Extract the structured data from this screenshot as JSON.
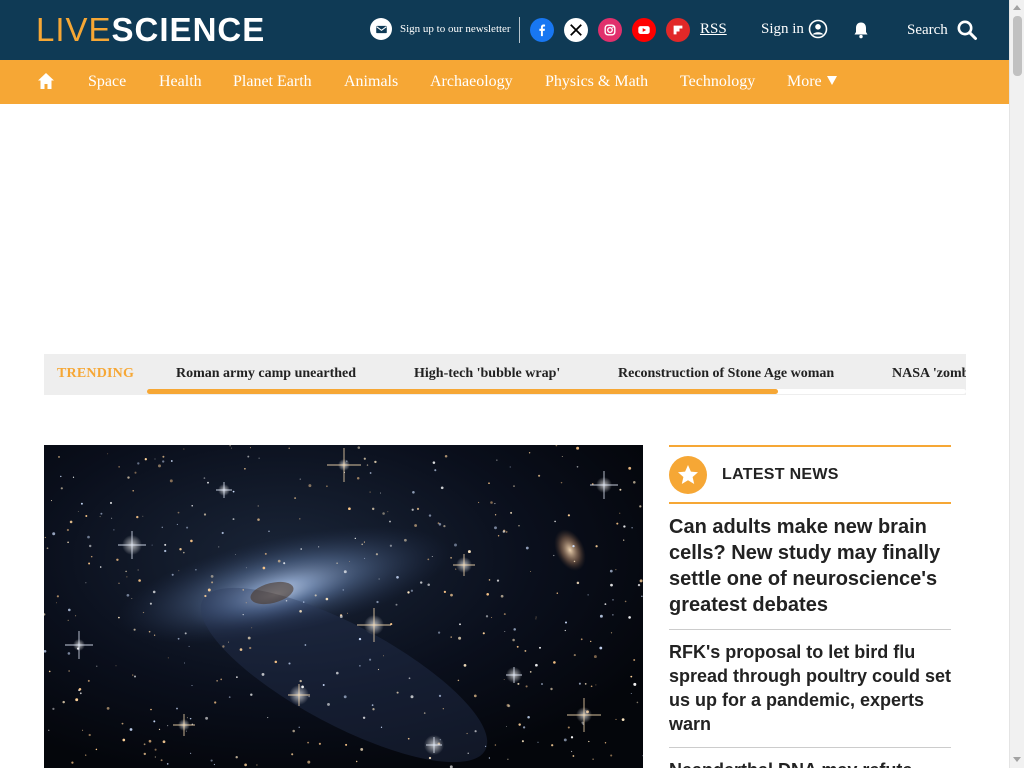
{
  "header": {
    "logo_live": "LIVE",
    "logo_science": "SCIENCE",
    "newsletter_label": "Sign up to our newsletter",
    "social": [
      {
        "icon": "facebook-icon",
        "color": "#1877f2"
      },
      {
        "icon": "x-icon",
        "color": "#000000"
      },
      {
        "icon": "instagram-icon",
        "color": "#e1306c"
      },
      {
        "icon": "youtube-icon",
        "color": "#ff0000"
      },
      {
        "icon": "flipboard-icon",
        "color": "#e12828"
      }
    ],
    "rss_label": "RSS",
    "signin_label": "Sign in",
    "search_label": "Search"
  },
  "nav": {
    "items": [
      "Space",
      "Health",
      "Planet Earth",
      "Animals",
      "Archaeology",
      "Physics & Math",
      "Technology",
      "More"
    ]
  },
  "trending": {
    "label": "TRENDING",
    "links": [
      "Roman army camp unearthed",
      "High-tech 'bubble wrap'",
      "Reconstruction of Stone Age woman",
      "NASA 'zombie"
    ],
    "scroll_progress": 0.77
  },
  "latest_news": {
    "title": "LATEST NEWS",
    "items": [
      "Can adults make new brain cells? New study may finally settle one of neuroscience's greatest debates",
      "RFK's proposal to let bird flu spread through poultry could set us up for a pandemic, experts warn",
      "Neanderthal DNA may refute"
    ]
  },
  "colors": {
    "header_bg": "#0f3a55",
    "accent": "#f6a735",
    "trending_bg": "#eeeeee"
  }
}
